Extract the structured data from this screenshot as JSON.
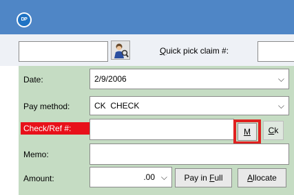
{
  "app": {
    "logo_text": "DP"
  },
  "toolbar": {
    "quick_pick_pre": "",
    "quick_pick_hotkey": "Q",
    "quick_pick_rest": "uick pick claim #:",
    "claim_value": "",
    "quick_pick_value": ""
  },
  "form": {
    "date_label": "Date:",
    "date_value": "2/9/2006",
    "pay_method_label": "Pay method:",
    "pay_method_value": "CK  CHECK",
    "check_label": "Check/Ref #:",
    "check_value": "",
    "memo_label": "Memo:",
    "memo_value": "",
    "amount_label": "Amount:",
    "amount_value": ".00"
  },
  "buttons": {
    "m_hotkey": "M",
    "ck_hotkey": "C",
    "ck_rest": "k",
    "pay_in_full_pre": "Pay in ",
    "pay_in_full_hotkey": "F",
    "pay_in_full_rest": "ull",
    "allocate_hotkey": "A",
    "allocate_rest": "llocate"
  },
  "colors": {
    "titlebar": "#4f86c6",
    "form_background": "#c5dcc3",
    "required_label_bg": "#e8101a",
    "highlight_outline": "#e0201f"
  },
  "icons": {
    "app": "dp-logo-icon",
    "person": "person-lookup-icon",
    "dropdown": "chevron-down-icon"
  }
}
